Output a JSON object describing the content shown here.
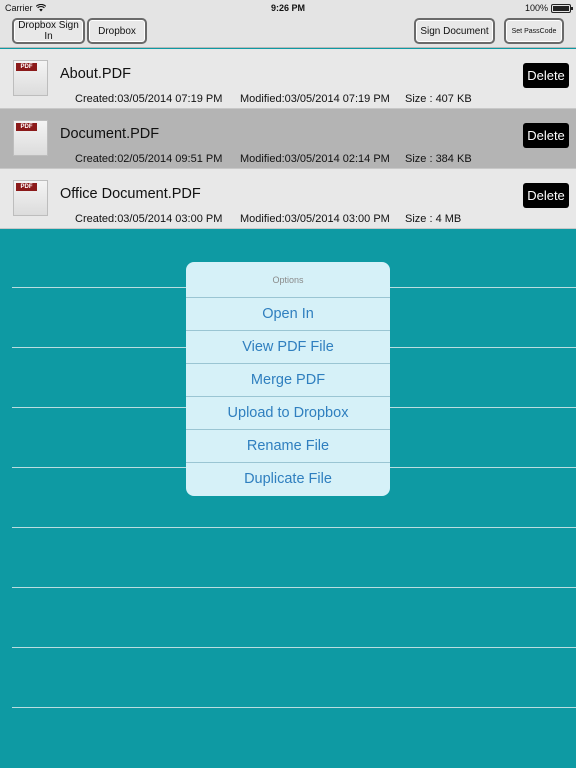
{
  "status_bar": {
    "carrier": "Carrier",
    "time": "9:26 PM",
    "battery": "100%"
  },
  "toolbar": {
    "dropbox_sign_in": "Dropbox Sign In",
    "dropbox": "Dropbox",
    "sign_document": "Sign Document",
    "set_passcode": "Set PassCode"
  },
  "files": [
    {
      "icon_label": "PDF",
      "name": "About.PDF",
      "created": "Created:03/05/2014 07:19 PM",
      "modified": "Modified:03/05/2014 07:19 PM",
      "size": "Size : 407 KB",
      "delete": "Delete",
      "selected": false
    },
    {
      "icon_label": "PDF",
      "name": "Document.PDF",
      "created": "Created:02/05/2014 09:51 PM",
      "modified": "Modified:03/05/2014 02:14 PM",
      "size": "Size : 384 KB",
      "delete": "Delete",
      "selected": true
    },
    {
      "icon_label": "PDF",
      "name": "Office Document.PDF",
      "created": "Created:03/05/2014 03:00 PM",
      "modified": "Modified:03/05/2014 03:00 PM",
      "size": "Size : 4 MB",
      "delete": "Delete",
      "selected": false
    }
  ],
  "options_popup": {
    "title": "Options",
    "items": [
      "Open In",
      "View PDF File",
      "Merge PDF",
      "Upload to Dropbox",
      "Rename File",
      "Duplicate File"
    ]
  },
  "colors": {
    "background": "#0e9aa3",
    "popup": "#d6f1f8",
    "popup_text": "#2f7fbf",
    "selected_row": "#b4b4b4"
  }
}
